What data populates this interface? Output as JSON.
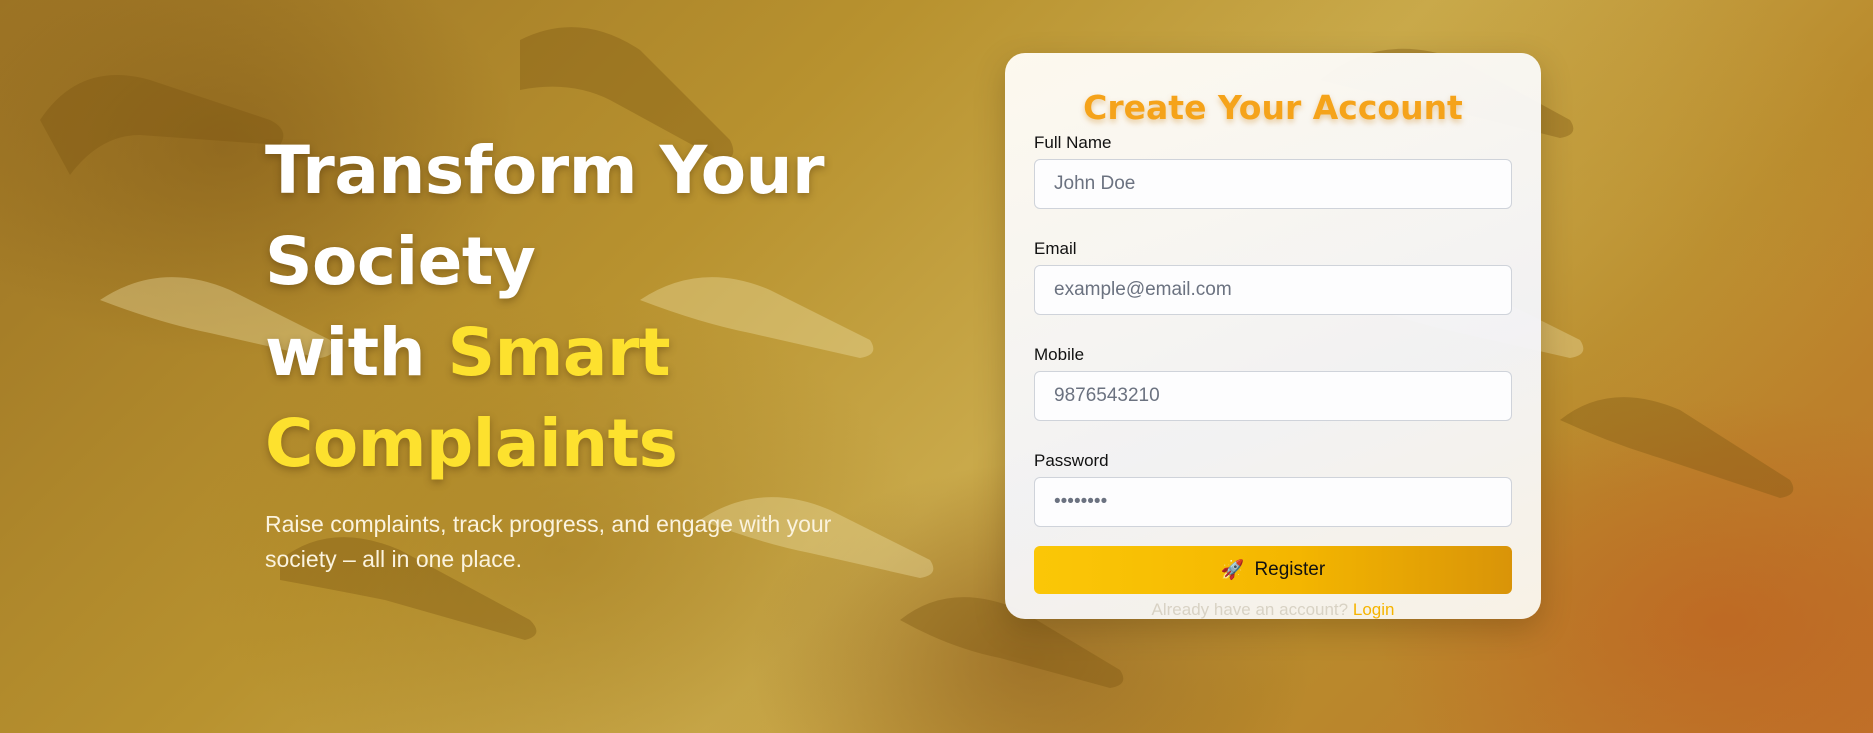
{
  "hero": {
    "line1": "Transform Your",
    "line2": "Society",
    "line3_prefix": "with ",
    "line3_highlight": "Smart",
    "line4_highlight": "Complaints",
    "subtitle": "Raise complaints, track progress, and engage with your society – all in one place."
  },
  "form": {
    "title": "Create Your Account",
    "fields": [
      {
        "label": "Full Name",
        "placeholder": "John Doe",
        "type": "text"
      },
      {
        "label": "Email",
        "placeholder": "example@email.com",
        "type": "email"
      },
      {
        "label": "Mobile",
        "placeholder": "9876543210",
        "type": "tel"
      },
      {
        "label": "Password",
        "placeholder": "••••••••",
        "type": "password"
      }
    ],
    "register_label": "Register",
    "register_icon": "rocket-icon",
    "footer_text": "Already have an account?",
    "login_link": "Login"
  },
  "colors": {
    "accent_yellow": "#fde12e",
    "title_orange": "#f5a31a",
    "button_yellow": "#fbc707",
    "login_link": "#f6b400"
  }
}
